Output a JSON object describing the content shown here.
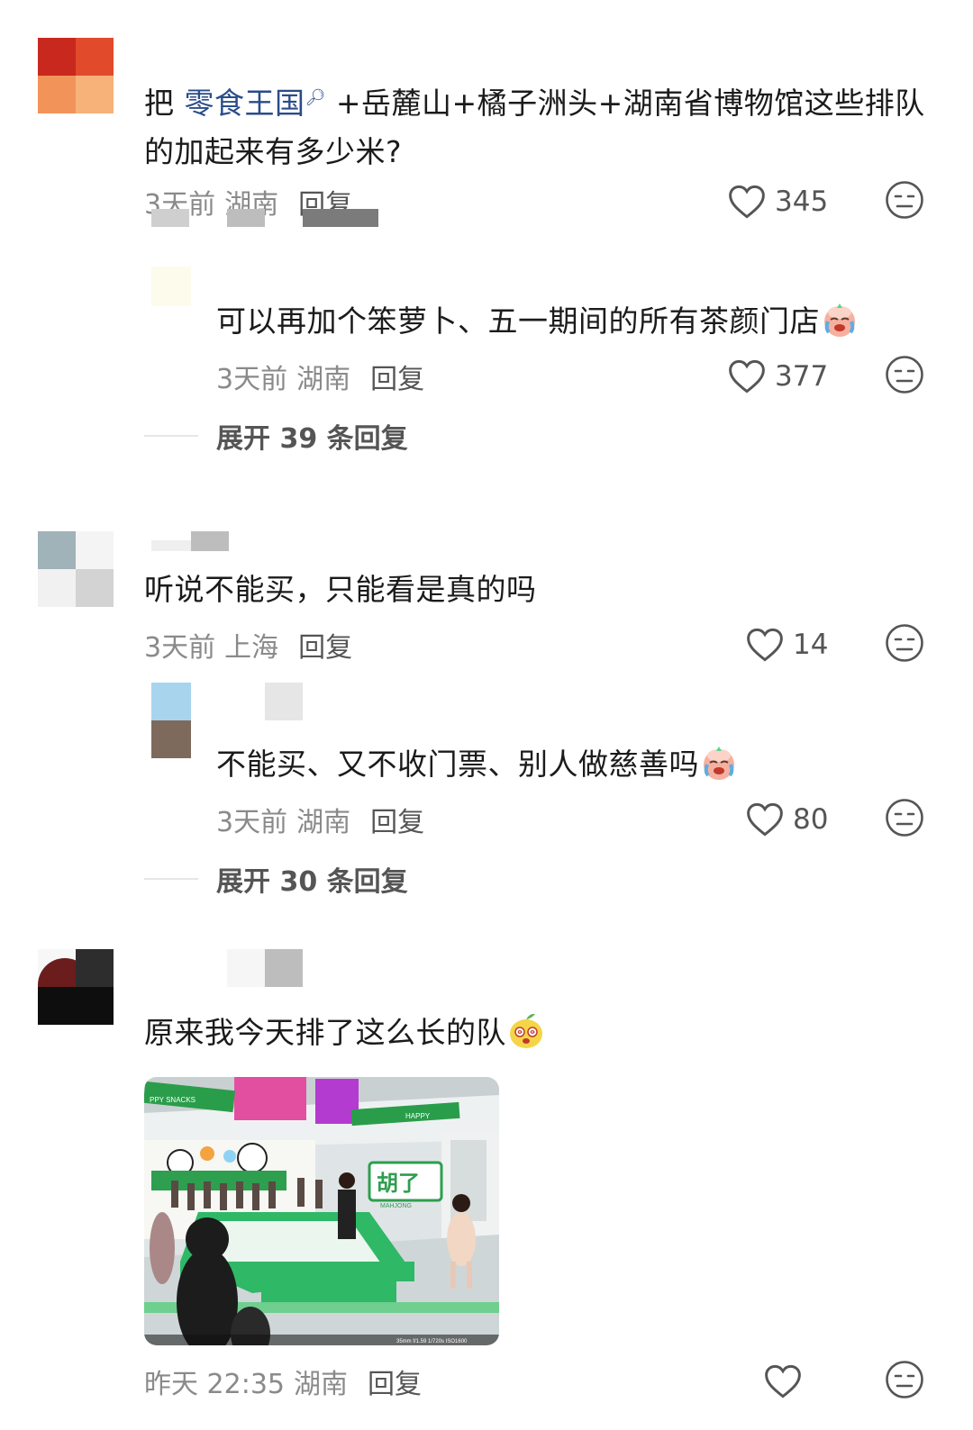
{
  "comments": [
    {
      "text_prefix": "把 ",
      "mention": "零食王国",
      "text_suffix": " +岳麓山+橘子洲头+湖南省博物馆这些排队的加起来有多少米?",
      "time": "3天前",
      "location": "湖南",
      "reply_label": "回复",
      "likes": "345",
      "replies": [
        {
          "text": "可以再加个笨萝卜、五一期间的所有茶颜门店",
          "emoji": "crying-face",
          "time": "3天前",
          "location": "湖南",
          "reply_label": "回复",
          "likes": "377"
        }
      ],
      "expand_label": "展开 39 条回复"
    },
    {
      "text": "听说不能买，只能看是真的吗",
      "time": "3天前",
      "location": "上海",
      "reply_label": "回复",
      "likes": "14",
      "replies": [
        {
          "text": "不能买、又不收门票、别人做慈善吗",
          "emoji": "crying-face",
          "time": "3天前",
          "location": "湖南",
          "reply_label": "回复",
          "likes": "80"
        }
      ],
      "expand_label": "展开 30 条回复"
    },
    {
      "text": "原来我今天排了这么长的队",
      "emoji": "dizzy-fruit-face",
      "time": "昨天 22:35",
      "location": "湖南",
      "reply_label": "回复",
      "likes": "",
      "image": {
        "banner_left": "PPY SNACKS",
        "banner_right": "HAPPY",
        "sign_main": "胡了",
        "sign_sub": "MAHJONG",
        "camera_info": "35mm  f/1.59  1/720s  ISO1600"
      }
    }
  ],
  "colors": {
    "text": "#1b1b1b",
    "meta": "#8a8a8a",
    "mention": "#2a4c8a",
    "icon": "#555555"
  }
}
